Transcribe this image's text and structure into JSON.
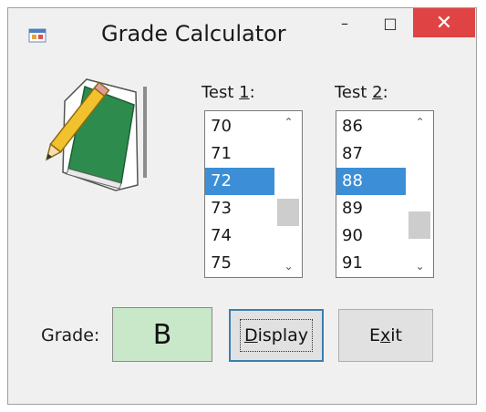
{
  "window": {
    "title": "Grade Calculator",
    "minimize_glyph": "–",
    "maximize_glyph": "□",
    "close_glyph": "✕"
  },
  "test1": {
    "label_prefix": "Test ",
    "label_mnemonic": "1",
    "label_suffix": ":",
    "items": [
      "70",
      "71",
      "72",
      "73",
      "74",
      "75"
    ],
    "selected": "72"
  },
  "test2": {
    "label_prefix": "Test ",
    "label_mnemonic": "2",
    "label_suffix": ":",
    "items": [
      "86",
      "87",
      "88",
      "89",
      "90",
      "91"
    ],
    "selected": "88"
  },
  "grade": {
    "label": "Grade:",
    "value": "B"
  },
  "buttons": {
    "display_mnemonic": "D",
    "display_rest": "isplay",
    "exit_first": "E",
    "exit_mnemonic": "x",
    "exit_rest": "it"
  },
  "colors": {
    "selection": "#3c8fd6",
    "grade_bg": "#c9e8c9",
    "close_bg": "#e04343",
    "book_green": "#2e8b4e",
    "pencil_yellow": "#f2c12e"
  },
  "icons": {
    "app": "form-icon",
    "art": "book-pencil-icon"
  }
}
